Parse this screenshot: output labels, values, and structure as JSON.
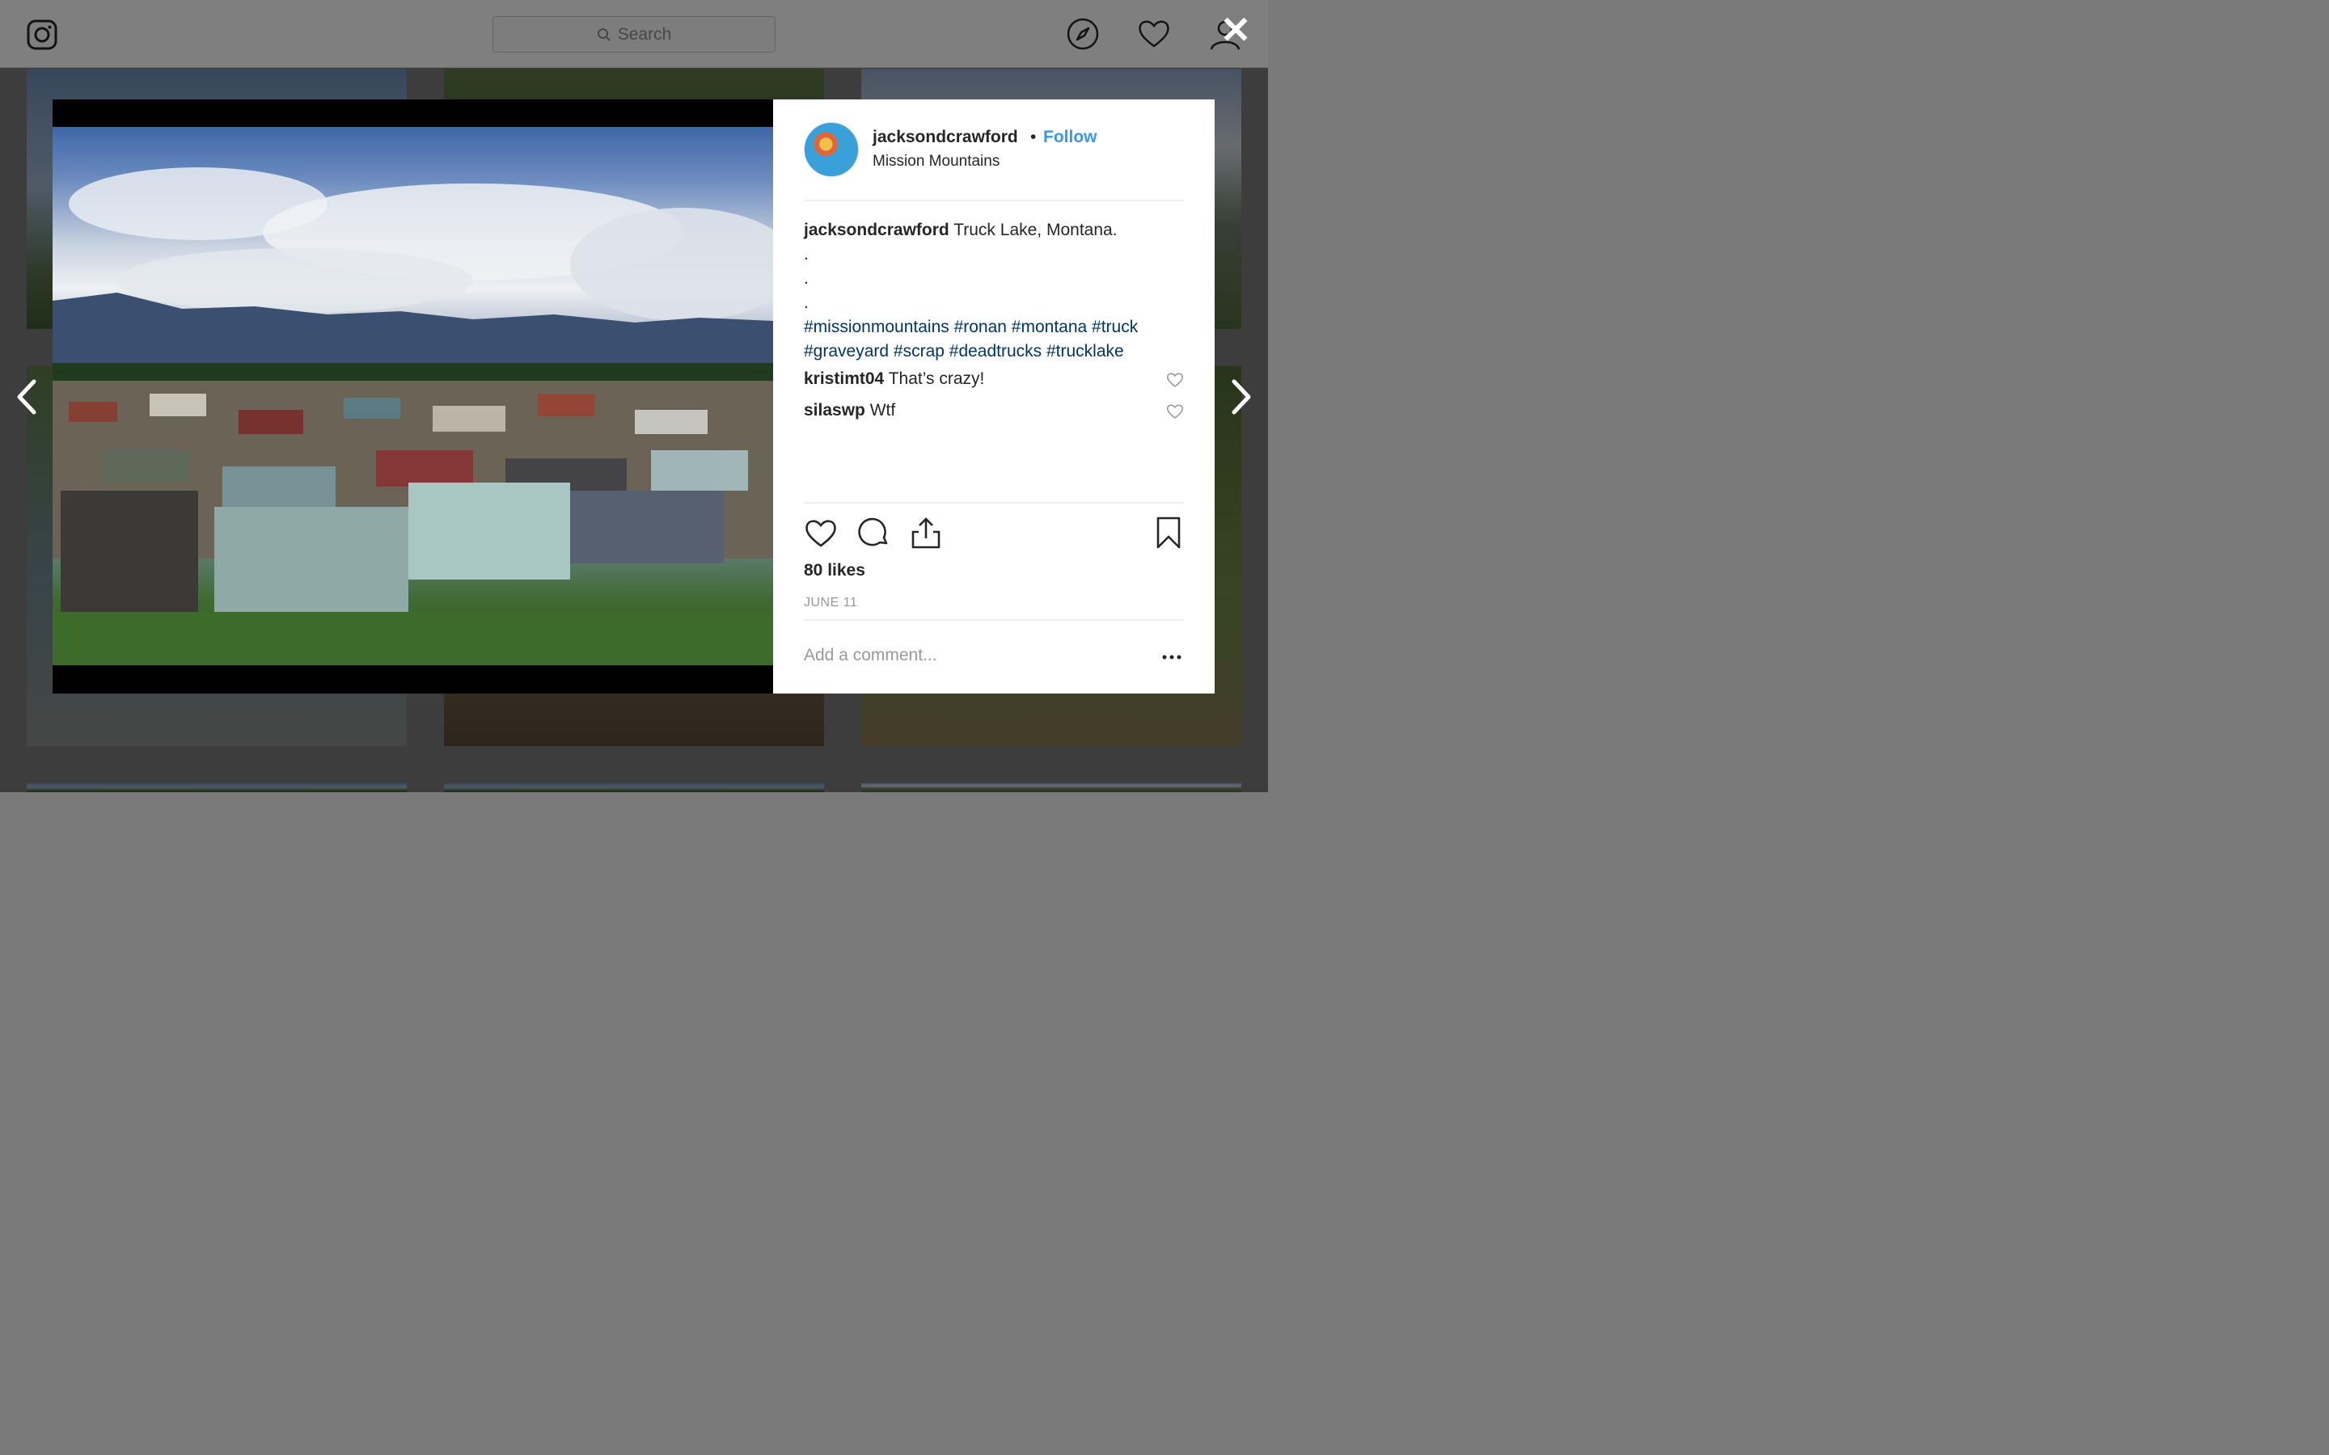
{
  "nav": {
    "search_placeholder": "Search"
  },
  "post": {
    "username": "jacksondcrawford",
    "separator": "•",
    "follow_label": "Follow",
    "location": "Mission Mountains",
    "caption": {
      "username": "jacksondcrawford",
      "text": "Truck Lake, Montana.",
      "dots": [
        ".",
        ".",
        "."
      ],
      "hashtags_line1": "#missionmountains #ronan #montana #truck",
      "hashtags_line2": "#graveyard #scrap #deadtrucks #trucklake"
    },
    "comments": [
      {
        "username": "kristimt04",
        "text": "That’s crazy!"
      },
      {
        "username": "silaswp",
        "text": "Wtf"
      }
    ],
    "likes": "80 likes",
    "date": "JUNE 11",
    "add_comment_placeholder": "Add a comment...",
    "more_label": "•••"
  },
  "overlay": {
    "close_label": "✕"
  },
  "icons": {
    "logo": "instagram-logo-icon",
    "explore": "compass-icon",
    "activity": "heart-icon",
    "profile": "user-icon",
    "like": "heart-icon",
    "comment": "comment-bubble-icon",
    "share": "share-icon",
    "save": "bookmark-icon"
  },
  "colors": {
    "link": "#3897f0",
    "hashtag": "#003569",
    "text": "#262626",
    "muted": "#999999"
  }
}
